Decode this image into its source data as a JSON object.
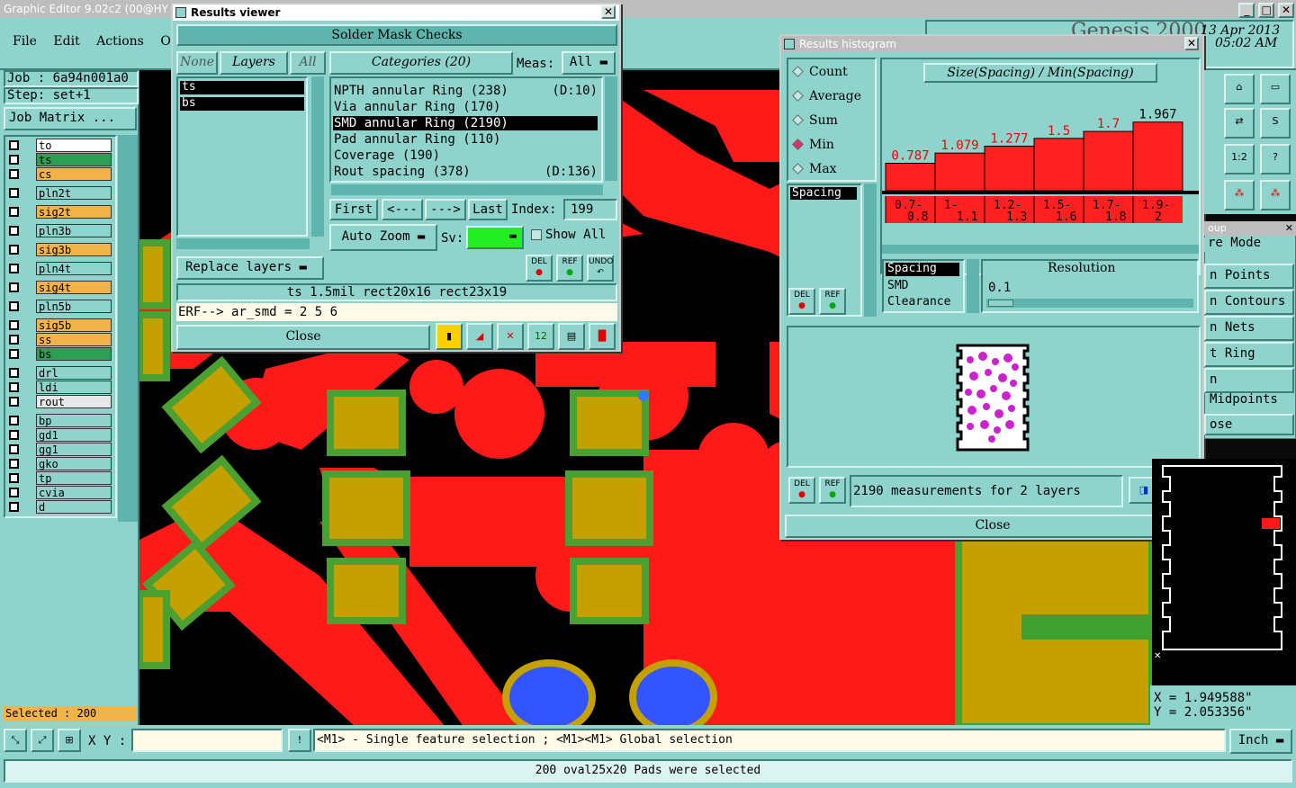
{
  "app": {
    "title": "Graphic Editor 9.02c2 (00@HY",
    "genesis": "Genesis 2000",
    "date": "13 Apr 2013",
    "time": "05:02 AM"
  },
  "menu": [
    "File",
    "Edit",
    "Actions",
    "Opti"
  ],
  "job": {
    "job": "Job : 6a94n001a0",
    "step": "Step: set+1",
    "matrix": "Job Matrix ..."
  },
  "layers": [
    {
      "name": "to",
      "color": "#ffffff"
    },
    {
      "name": "ts",
      "color": "#2e9e55"
    },
    {
      "name": "cs",
      "color": "#f2b448"
    },
    {
      "name": "pln2t",
      "color": "#8fd3cd"
    },
    {
      "name": "sig2t",
      "color": "#f2b448"
    },
    {
      "name": "pln3b",
      "color": "#8fd3cd"
    },
    {
      "name": "sig3b",
      "color": "#f2b448"
    },
    {
      "name": "pln4t",
      "color": "#8fd3cd"
    },
    {
      "name": "sig4t",
      "color": "#f2b448"
    },
    {
      "name": "pln5b",
      "color": "#8fd3cd"
    },
    {
      "name": "sig5b",
      "color": "#f2b448"
    },
    {
      "name": "ss",
      "color": "#f2b448"
    },
    {
      "name": "bs",
      "color": "#2e9e55"
    },
    {
      "name": "drl",
      "color": "#8fd3cd"
    },
    {
      "name": "ldi",
      "color": "#8fd3cd"
    },
    {
      "name": "rout",
      "color": "#e8e8e8"
    },
    {
      "name": "bp",
      "color": "#8fd3cd"
    },
    {
      "name": "gd1",
      "color": "#8fd3cd"
    },
    {
      "name": "gg1",
      "color": "#8fd3cd"
    },
    {
      "name": "gko",
      "color": "#8fd3cd"
    },
    {
      "name": "tp",
      "color": "#8fd3cd"
    },
    {
      "name": "cvia",
      "color": "#8fd3cd"
    },
    {
      "name": "d",
      "color": "#8fd3cd"
    }
  ],
  "selected": "Selected : 200",
  "results": {
    "title": "Results viewer",
    "header": "Solder Mask Checks",
    "none": "None",
    "layers": "Layers",
    "all": "All",
    "categories": "Categories (20)",
    "meas_label": "Meas:",
    "meas_value": "All",
    "layer_items": [
      "ts",
      "bs"
    ],
    "category_items": [
      {
        "text": "NPTH annular Ring (238)",
        "tag": "(D:10)"
      },
      {
        "text": "Via annular Ring (170)",
        "tag": ""
      },
      {
        "text": "SMD annular Ring (2190)",
        "tag": ""
      },
      {
        "text": "Pad annular Ring (110)",
        "tag": ""
      },
      {
        "text": "Coverage (190)",
        "tag": ""
      },
      {
        "text": "Rout spacing (378)",
        "tag": "(D:136)"
      }
    ],
    "first": "First",
    "prev": "<---",
    "next": "--->",
    "last": "Last",
    "index_label": "Index:",
    "index_value": "199",
    "autozoom": "Auto Zoom",
    "sv": "Sv:",
    "showall": "Show All",
    "replace": "Replace layers",
    "info": "ts 1.5mil  rect20x16  rect23x19",
    "erf": "ERF--> ar_smd = 2 5 6",
    "close": "Close",
    "del": "DEL",
    "ref": "REF",
    "undo": "UNDO"
  },
  "histogram": {
    "title": "Results histogram",
    "options": [
      "Count",
      "Average",
      "Sum",
      "Min",
      "Max"
    ],
    "selected_option": "Min",
    "chart_title": "Size(Spacing) / Min(Spacing)",
    "list_item": "Spacing",
    "types": [
      "Spacing",
      "SMD",
      "Clearance"
    ],
    "resolution_label": "Resolution",
    "resolution_value": "0.1",
    "summary": "2190 measurements for 2 layers",
    "close": "Close",
    "del": "DEL",
    "ref": "REF"
  },
  "chart_data": {
    "type": "bar",
    "title": "Size(Spacing) / Min(Spacing)",
    "categories": [
      [
        "0.7-",
        "0.8"
      ],
      [
        "1-",
        "1.1"
      ],
      [
        "1.2-",
        "1.3"
      ],
      [
        "1.5-",
        "1.6"
      ],
      [
        "1.7-",
        "1.8"
      ],
      [
        "1.9-",
        "2"
      ]
    ],
    "values": [
      0.787,
      1.079,
      1.277,
      1.5,
      1.7,
      1.967
    ],
    "labels": [
      "0.787",
      "1.079",
      "1.277",
      "1.5",
      "1.7",
      "1.967"
    ],
    "ylim": [
      0,
      2.6
    ],
    "color": "#ff2020"
  },
  "right_panel": {
    "title": "oup",
    "items": [
      "re Mode",
      "n Points",
      "n Contours",
      "n Nets",
      "t Ring",
      "n Midpoints"
    ],
    "close": "ose"
  },
  "coords": {
    "x": "X = 1.949588\"",
    "y": "Y = 2.053356\""
  },
  "status": {
    "xy_label": "X Y :",
    "hint": "<M1> - Single feature selection ; <M1><M1> Global selection",
    "unit": "Inch",
    "message": "200 oval25x20 Pads were selected"
  }
}
